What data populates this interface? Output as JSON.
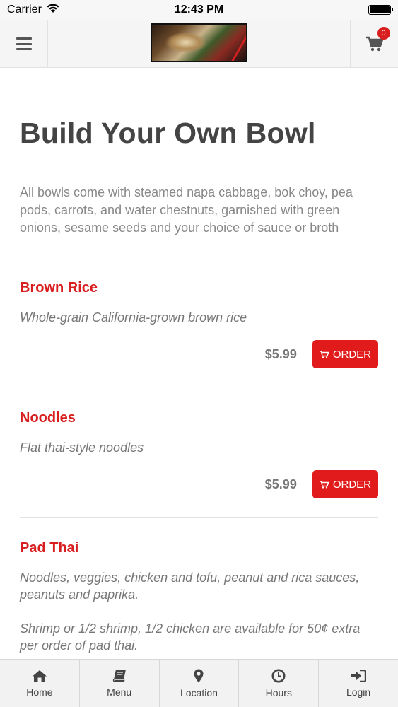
{
  "status_bar": {
    "carrier": "Carrier",
    "time": "12:43 PM"
  },
  "header": {
    "cart_count": "0"
  },
  "page": {
    "title": "Build Your Own Bowl",
    "intro": "All bowls come with steamed napa cabbage, bok choy, pea pods, carrots, and water chestnuts, garnished with green onions, sesame seeds and your choice of sauce or broth"
  },
  "items": [
    {
      "name": "Brown Rice",
      "description": "Whole-grain California-grown brown rice",
      "price": "$5.99",
      "order_label": "ORDER"
    },
    {
      "name": "Noodles",
      "description": "Flat thai-style noodles",
      "price": "$5.99",
      "order_label": "ORDER"
    },
    {
      "name": "Pad Thai",
      "description": "Noodles, veggies, chicken and tofu, peanut and rica sauces, peanuts and paprika.",
      "description2": "Shrimp or 1/2 shrimp, 1/2 chicken are available for 50¢ extra per order of pad thai."
    }
  ],
  "tabs": [
    {
      "label": "Home",
      "icon": "home-icon"
    },
    {
      "label": "Menu",
      "icon": "book-icon"
    },
    {
      "label": "Location",
      "icon": "map-pin-icon"
    },
    {
      "label": "Hours",
      "icon": "clock-icon"
    },
    {
      "label": "Login",
      "icon": "login-icon"
    }
  ],
  "colors": {
    "accent": "#e11b1b",
    "item_name": "#d81e1e",
    "title": "#444444"
  }
}
